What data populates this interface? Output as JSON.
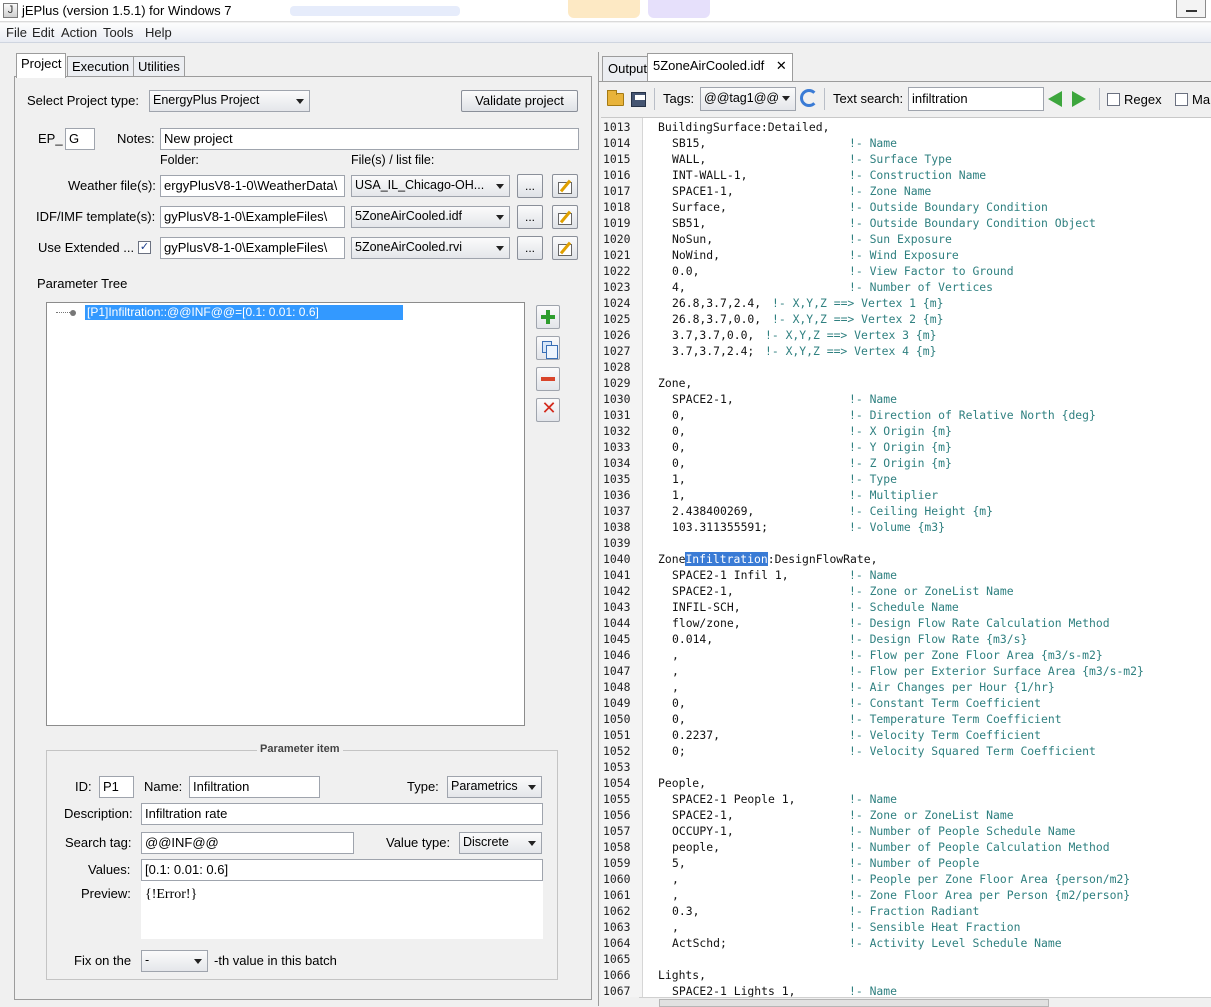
{
  "window": {
    "title": "jEPlus (version 1.5.1) for Windows 7",
    "icon_name": "jeplus-app-icon"
  },
  "menu": [
    "File",
    "Edit",
    "Action",
    "Tools",
    "Help"
  ],
  "left": {
    "tabs": [
      "Project",
      "Execution",
      "Utilities"
    ],
    "project_type_label": "Select Project type:",
    "project_type_value": "EnergyPlus Project",
    "validate_label": "Validate project",
    "ep_label": "EP_",
    "ep_value": "G",
    "notes_label": "Notes:",
    "notes_value": "New project",
    "folder_header": "Folder:",
    "files_header": "File(s) / list file:",
    "rows": [
      {
        "label": "Weather file(s):",
        "folder": "ergyPlusV8-1-0\\WeatherData\\",
        "file": "USA_IL_Chicago-OH..."
      },
      {
        "label": "IDF/IMF template(s):",
        "folder": "gyPlusV8-1-0\\ExampleFiles\\",
        "file": "5ZoneAirCooled.idf"
      },
      {
        "label": "Use Extended ...",
        "folder": "gyPlusV8-1-0\\ExampleFiles\\",
        "file": "5ZoneAirCooled.rvi",
        "checked": true
      }
    ],
    "browse_label": "...",
    "param_tree_label": "Parameter Tree",
    "tree_node": "[P1]Infiltration::@@INF@@=[0.1: 0.01: 0.6]",
    "item": {
      "legend": "Parameter item",
      "id_label": "ID:",
      "id_value": "P1",
      "name_label": "Name:",
      "name_value": "Infiltration",
      "type_label": "Type:",
      "type_value": "Parametrics",
      "desc_label": "Description:",
      "desc_value": "Infiltration rate",
      "search_label": "Search tag:",
      "search_value": "@@INF@@",
      "vtype_label": "Value type:",
      "vtype_value": "Discrete",
      "values_label": "Values:",
      "values_value": "[0.1: 0.01: 0.6]",
      "preview_label": "Preview:",
      "preview_value": "{!Error!}",
      "fix_label": "Fix on the",
      "fix_value": "-",
      "fix_suffix": "-th value in this batch"
    }
  },
  "right": {
    "tabs": [
      "Output",
      "5ZoneAirCooled.idf"
    ],
    "tags_label": "Tags:",
    "tags_value": "@@tag1@@",
    "search_label": "Text search:",
    "search_value": "infiltration",
    "regex_label": "Regex",
    "match_label": "Ma",
    "highlight_word": "Infiltration",
    "lines": [
      {
        "n": "1013",
        "code": "BuildingSurface:Detailed,",
        "cm": "",
        "indent": 0
      },
      {
        "n": "1014",
        "code": "SB15,",
        "cm": "!- Name",
        "indent": 1
      },
      {
        "n": "1015",
        "code": "WALL,",
        "cm": "!- Surface Type",
        "indent": 1
      },
      {
        "n": "1016",
        "code": "INT-WALL-1,",
        "cm": "!- Construction Name",
        "indent": 1
      },
      {
        "n": "1017",
        "code": "SPACE1-1,",
        "cm": "!- Zone Name",
        "indent": 1
      },
      {
        "n": "1018",
        "code": "Surface,",
        "cm": "!- Outside Boundary Condition",
        "indent": 1
      },
      {
        "n": "1019",
        "code": "SB51,",
        "cm": "!- Outside Boundary Condition Object",
        "indent": 1
      },
      {
        "n": "1020",
        "code": "NoSun,",
        "cm": "!- Sun Exposure",
        "indent": 1
      },
      {
        "n": "1021",
        "code": "NoWind,",
        "cm": "!- Wind Exposure",
        "indent": 1
      },
      {
        "n": "1022",
        "code": "0.0,",
        "cm": "!- View Factor to Ground",
        "indent": 1
      },
      {
        "n": "1023",
        "code": "4,",
        "cm": "!- Number of Vertices",
        "indent": 1
      },
      {
        "n": "1024",
        "code": "26.8,3.7,2.4,",
        "cm": "!- X,Y,Z ==> Vertex 1 {m}",
        "indent": 1,
        "short": true
      },
      {
        "n": "1025",
        "code": "26.8,3.7,0.0,",
        "cm": "!- X,Y,Z ==> Vertex 2 {m}",
        "indent": 1,
        "short": true
      },
      {
        "n": "1026",
        "code": "3.7,3.7,0.0,",
        "cm": "!- X,Y,Z ==> Vertex 3 {m}",
        "indent": 1,
        "short": true
      },
      {
        "n": "1027",
        "code": "3.7,3.7,2.4;",
        "cm": "!- X,Y,Z ==> Vertex 4 {m}",
        "indent": 1,
        "short": true
      },
      {
        "n": "1028",
        "code": "",
        "cm": "",
        "indent": 0
      },
      {
        "n": "1029",
        "code": "Zone,",
        "cm": "",
        "indent": 0
      },
      {
        "n": "1030",
        "code": "SPACE2-1,",
        "cm": "!- Name",
        "indent": 1
      },
      {
        "n": "1031",
        "code": "0,",
        "cm": "!- Direction of Relative North {deg}",
        "indent": 1
      },
      {
        "n": "1032",
        "code": "0,",
        "cm": "!- X Origin {m}",
        "indent": 1
      },
      {
        "n": "1033",
        "code": "0,",
        "cm": "!- Y Origin {m}",
        "indent": 1
      },
      {
        "n": "1034",
        "code": "0,",
        "cm": "!- Z Origin {m}",
        "indent": 1
      },
      {
        "n": "1035",
        "code": "1,",
        "cm": "!- Type",
        "indent": 1
      },
      {
        "n": "1036",
        "code": "1,",
        "cm": "!- Multiplier",
        "indent": 1
      },
      {
        "n": "1037",
        "code": "2.438400269,",
        "cm": "!- Ceiling Height {m}",
        "indent": 1
      },
      {
        "n": "1038",
        "code": "103.311355591;",
        "cm": "!- Volume {m3}",
        "indent": 1
      },
      {
        "n": "1039",
        "code": "",
        "cm": "",
        "indent": 0
      },
      {
        "n": "1040",
        "code": "ZoneInfiltration:DesignFlowRate,",
        "cm": "",
        "indent": 0,
        "highlight": true
      },
      {
        "n": "1041",
        "code": "SPACE2-1 Infil 1,",
        "cm": "!- Name",
        "indent": 1
      },
      {
        "n": "1042",
        "code": "SPACE2-1,",
        "cm": "!- Zone or ZoneList Name",
        "indent": 1
      },
      {
        "n": "1043",
        "code": "INFIL-SCH,",
        "cm": "!- Schedule Name",
        "indent": 1
      },
      {
        "n": "1044",
        "code": "flow/zone,",
        "cm": "!- Design Flow Rate Calculation Method",
        "indent": 1
      },
      {
        "n": "1045",
        "code": "0.014,",
        "cm": "!- Design Flow Rate {m3/s}",
        "indent": 1
      },
      {
        "n": "1046",
        "code": ",",
        "cm": "!- Flow per Zone Floor Area {m3/s-m2}",
        "indent": 1
      },
      {
        "n": "1047",
        "code": ",",
        "cm": "!- Flow per Exterior Surface Area {m3/s-m2}",
        "indent": 1
      },
      {
        "n": "1048",
        "code": ",",
        "cm": "!- Air Changes per Hour {1/hr}",
        "indent": 1
      },
      {
        "n": "1049",
        "code": "0,",
        "cm": "!- Constant Term Coefficient",
        "indent": 1
      },
      {
        "n": "1050",
        "code": "0,",
        "cm": "!- Temperature Term Coefficient",
        "indent": 1
      },
      {
        "n": "1051",
        "code": "0.2237,",
        "cm": "!- Velocity Term Coefficient",
        "indent": 1
      },
      {
        "n": "1052",
        "code": "0;",
        "cm": "!- Velocity Squared Term Coefficient",
        "indent": 1
      },
      {
        "n": "1053",
        "code": "",
        "cm": "",
        "indent": 0
      },
      {
        "n": "1054",
        "code": "People,",
        "cm": "",
        "indent": 0
      },
      {
        "n": "1055",
        "code": "SPACE2-1 People 1,",
        "cm": "!- Name",
        "indent": 1
      },
      {
        "n": "1056",
        "code": "SPACE2-1,",
        "cm": "!- Zone or ZoneList Name",
        "indent": 1
      },
      {
        "n": "1057",
        "code": "OCCUPY-1,",
        "cm": "!- Number of People Schedule Name",
        "indent": 1
      },
      {
        "n": "1058",
        "code": "people,",
        "cm": "!- Number of People Calculation Method",
        "indent": 1
      },
      {
        "n": "1059",
        "code": "5,",
        "cm": "!- Number of People",
        "indent": 1
      },
      {
        "n": "1060",
        "code": ",",
        "cm": "!- People per Zone Floor Area {person/m2}",
        "indent": 1
      },
      {
        "n": "1061",
        "code": ",",
        "cm": "!- Zone Floor Area per Person {m2/person}",
        "indent": 1
      },
      {
        "n": "1062",
        "code": "0.3,",
        "cm": "!- Fraction Radiant",
        "indent": 1
      },
      {
        "n": "1063",
        "code": ",",
        "cm": "!- Sensible Heat Fraction",
        "indent": 1
      },
      {
        "n": "1064",
        "code": "ActSchd;",
        "cm": "!- Activity Level Schedule Name",
        "indent": 1
      },
      {
        "n": "1065",
        "code": "",
        "cm": "",
        "indent": 0
      },
      {
        "n": "1066",
        "code": "Lights,",
        "cm": "",
        "indent": 0
      },
      {
        "n": "1067",
        "code": "SPACE2-1 Lights 1,",
        "cm": "!- Name",
        "indent": 1
      }
    ]
  }
}
